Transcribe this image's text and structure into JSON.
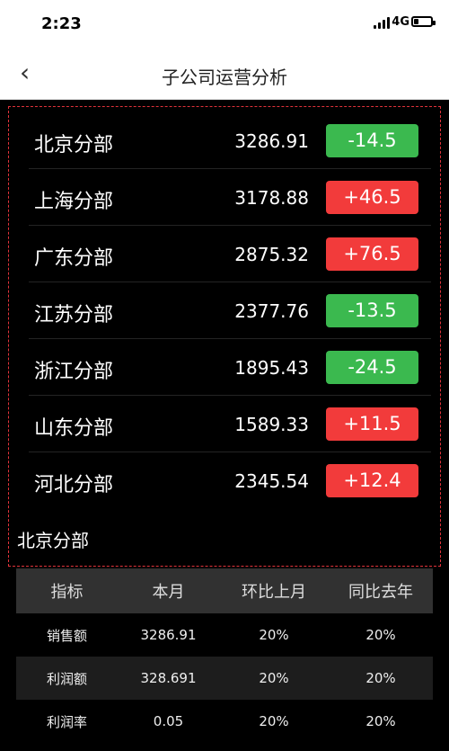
{
  "status": {
    "time": "2:23",
    "network": "4G"
  },
  "nav": {
    "title": "子公司运营分析"
  },
  "branches": [
    {
      "name": "北京分部",
      "value": "3286.91",
      "change": "-14.5",
      "direction": "down"
    },
    {
      "name": "上海分部",
      "value": "3178.88",
      "change": "+46.5",
      "direction": "up"
    },
    {
      "name": "广东分部",
      "value": "2875.32",
      "change": "+76.5",
      "direction": "up"
    },
    {
      "name": "江苏分部",
      "value": "2377.76",
      "change": "-13.5",
      "direction": "down"
    },
    {
      "name": "浙江分部",
      "value": "1895.43",
      "change": "-24.5",
      "direction": "down"
    },
    {
      "name": "山东分部",
      "value": "1589.33",
      "change": "+11.5",
      "direction": "up"
    },
    {
      "name": "河北分部",
      "value": "2345.54",
      "change": "+12.4",
      "direction": "up"
    }
  ],
  "selected_branch": "北京分部",
  "table": {
    "headers": [
      "指标",
      "本月",
      "环比上月",
      "同比去年"
    ],
    "rows": [
      [
        "销售额",
        "3286.91",
        "20%",
        "20%"
      ],
      [
        "利润额",
        "328.691",
        "20%",
        "20%"
      ],
      [
        "利润率",
        "0.05",
        "20%",
        "20%"
      ]
    ]
  },
  "colors": {
    "up": "#f23b3b",
    "down": "#3bb94f",
    "highlight_border": "#e2333a"
  }
}
